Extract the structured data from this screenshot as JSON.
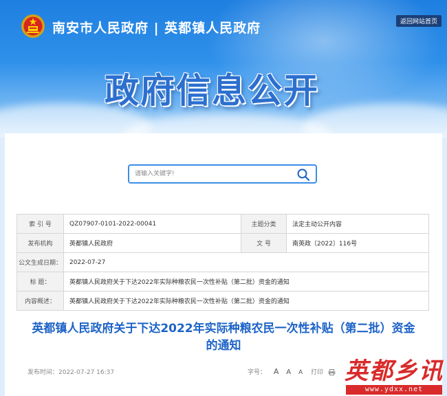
{
  "header": {
    "site_name": "南安市人民政府 | 英都镇人民政府",
    "home_link": "返回网站首页",
    "banner_title": "政府信息公开"
  },
  "search": {
    "placeholder": "请输入关键字!"
  },
  "meta": {
    "index_label": "索 引 号",
    "index_value": "QZ07907-0101-2022-00041",
    "category_label": "主题分类",
    "category_value": "法定主动公开内容",
    "publisher_label": "发布机构",
    "publisher_value": "英都镇人民政府",
    "docno_label": "文 号",
    "docno_value": "南英政〔2022〕116号",
    "date_label": "公文生成日期：",
    "date_value": "2022-07-27",
    "title_label": "标 题：",
    "title_value": "英都镇人民政府关于下达2022年实际种粮农民一次性补贴（第二批）资金的通知",
    "summary_label": "内容概述：",
    "summary_value": "英都镇人民政府关于下达2022年实际种粮农民一次性补贴（第二批）资金的通知"
  },
  "article": {
    "title_line1": "英都镇人民政府关于下达2022年实际种粮农民一次性补贴（第二批）资金",
    "title_line2": "的通知",
    "publish_time": "发布时间：2022-07-27 16:37",
    "font_size_label": "字号：",
    "font_large": "A",
    "font_medium": "A",
    "font_small": "A",
    "print_label": "打印"
  },
  "watermark": {
    "text": "英都乡讯",
    "url": "www.ydxx.net"
  },
  "colors": {
    "accent": "#1d63c7",
    "banner_blue": "#2f90ea",
    "watermark_red": "#d92b2b"
  }
}
